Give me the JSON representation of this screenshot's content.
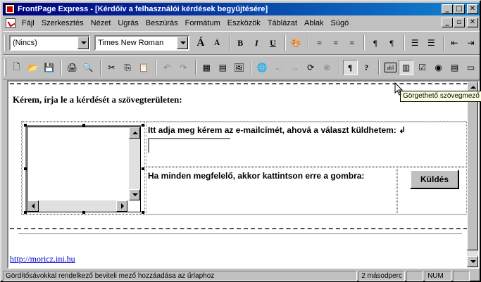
{
  "window": {
    "title": "FrontPage Express - [Kérdőív a felhasználói kérdések begyűjtésére]",
    "caption_buttons": [
      "_",
      "□",
      "✕"
    ],
    "mdi_buttons": [
      "_",
      "▫",
      "✕"
    ]
  },
  "menu": {
    "items": [
      "Fájl",
      "Szerkesztés",
      "Nézet",
      "Ugrás",
      "Beszúrás",
      "Formátum",
      "Eszközök",
      "Táblázat",
      "Ablak",
      "Súgó"
    ]
  },
  "format_toolbar": {
    "style_value": "(Nincs)",
    "font_value": "Times New Roman",
    "buttons": [
      "Á",
      "Á",
      "B",
      "I",
      "U",
      "🎨",
      "≡",
      "≡",
      "≡",
      "¶",
      "¶",
      "☰",
      "☰",
      "⇤",
      "⇥"
    ]
  },
  "standard_toolbar": {
    "buttons": [
      "🗋",
      "📂",
      "💾",
      "🖨",
      "🔍",
      "✂",
      "⎘",
      "📋",
      "↶",
      "↷",
      "▦",
      "▤",
      "🖼",
      "🌐",
      "←",
      "→",
      "⟳",
      "⊗",
      "¶",
      "?",
      "abl",
      "▥",
      "☑",
      "◉",
      "▤",
      "▭"
    ]
  },
  "document": {
    "prompt": "Kérem, írja le a kérdését a szövegterületen:",
    "email_label": "Itt adja meg kérem az e-mailcímét, ahová a választ küldhetem: ↲",
    "email_value": "",
    "submit_label": "Ha minden megfelelő, akkor kattintson erre a gombra:",
    "submit_button": "Küldés",
    "link": "http://moricz.ini.hu"
  },
  "tooltip": "Görgethető szövegmező",
  "statusbar": {
    "message": "Gördítősávokkal rendelkező beviteli mező hozzáadása az űrlaphoz",
    "time": "2 másodperc",
    "num": "NUM"
  }
}
